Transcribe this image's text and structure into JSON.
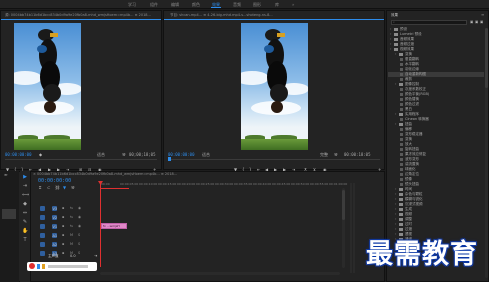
{
  "workspaces": [
    "学习",
    "组件",
    "编辑",
    "颜色",
    "效果",
    "音频",
    "图形",
    "库"
  ],
  "active_workspace_index": 4,
  "source_monitor": {
    "tab_title": "源: 0004bb74b11b6d1bcc834b0d9a9e20fb0a8-mhd_wmjsHoem=mp4b... ≡ 2018...",
    "timecode_left": "00:00:00:00",
    "timecode_right": "00;00;18;05",
    "fit": "适合"
  },
  "program_monitor": {
    "tab_title": "节目: shcan-mp4... ≡ 4-26-big-mhd.mp4-s...shoteng-ns-8...",
    "timecode_left": "00:00:00:00",
    "fit": "适合",
    "fraction": "完整",
    "timecode_right": "00:00:18:05"
  },
  "effects_panel": {
    "title": "效果",
    "search_placeholder": "",
    "items": [
      {
        "label": "预设",
        "level": 0,
        "type": "folder"
      },
      {
        "label": "Lumetri 预设",
        "level": 0,
        "type": "folder"
      },
      {
        "label": "音频效果",
        "level": 0,
        "type": "folder"
      },
      {
        "label": "音频过渡",
        "level": 0,
        "type": "folder"
      },
      {
        "label": "视频效果",
        "level": 0,
        "type": "folder"
      },
      {
        "label": "变换",
        "level": 1,
        "type": "folder"
      },
      {
        "label": "垂直翻转",
        "level": 2,
        "type": "effect"
      },
      {
        "label": "水平翻转",
        "level": 2,
        "type": "effect"
      },
      {
        "label": "羽化边缘",
        "level": 2,
        "type": "effect"
      },
      {
        "label": "自动重新构图",
        "level": 2,
        "type": "effect",
        "selected": true
      },
      {
        "label": "裁剪",
        "level": 2,
        "type": "effect"
      },
      {
        "label": "图像控制",
        "level": 1,
        "type": "folder"
      },
      {
        "label": "灰度系数校正",
        "level": 2,
        "type": "effect"
      },
      {
        "label": "颜色平衡(RGB)",
        "level": 2,
        "type": "effect"
      },
      {
        "label": "颜色替换",
        "level": 2,
        "type": "effect"
      },
      {
        "label": "颜色过滤",
        "level": 2,
        "type": "effect"
      },
      {
        "label": "黑白",
        "level": 2,
        "type": "effect"
      },
      {
        "label": "实用程序",
        "level": 1,
        "type": "folder"
      },
      {
        "label": "Cineon 转换器",
        "level": 2,
        "type": "effect"
      },
      {
        "label": "扭曲",
        "level": 1,
        "type": "folder"
      },
      {
        "label": "偏移",
        "level": 2,
        "type": "effect"
      },
      {
        "label": "变形稳定器",
        "level": 2,
        "type": "effect"
      },
      {
        "label": "变换",
        "level": 2,
        "type": "effect"
      },
      {
        "label": "放大",
        "level": 2,
        "type": "effect"
      },
      {
        "label": "旋转扭曲",
        "level": 2,
        "type": "effect"
      },
      {
        "label": "果冻效应修复",
        "level": 2,
        "type": "effect"
      },
      {
        "label": "波形变形",
        "level": 2,
        "type": "effect"
      },
      {
        "label": "湍流置换",
        "level": 2,
        "type": "effect"
      },
      {
        "label": "球面化",
        "level": 2,
        "type": "effect"
      },
      {
        "label": "边角定位",
        "level": 2,
        "type": "effect"
      },
      {
        "label": "镜像",
        "level": 2,
        "type": "effect"
      },
      {
        "label": "镜头扭曲",
        "level": 2,
        "type": "effect"
      },
      {
        "label": "时间",
        "level": 1,
        "type": "folder"
      },
      {
        "label": "杂色与颗粒",
        "level": 1,
        "type": "folder"
      },
      {
        "label": "模糊与锐化",
        "level": 1,
        "type": "folder"
      },
      {
        "label": "沉浸式视频",
        "level": 1,
        "type": "folder"
      },
      {
        "label": "生成",
        "level": 1,
        "type": "folder"
      },
      {
        "label": "视频",
        "level": 1,
        "type": "folder"
      },
      {
        "label": "调整",
        "level": 1,
        "type": "folder"
      },
      {
        "label": "过时",
        "level": 1,
        "type": "folder"
      },
      {
        "label": "过渡",
        "level": 1,
        "type": "folder"
      },
      {
        "label": "透视",
        "level": 1,
        "type": "folder"
      },
      {
        "label": "通道",
        "level": 1,
        "type": "folder"
      },
      {
        "label": "键控",
        "level": 1,
        "type": "folder"
      },
      {
        "label": "颜色校正",
        "level": 1,
        "type": "folder"
      },
      {
        "label": "风格化",
        "level": 1,
        "type": "folder"
      }
    ]
  },
  "timeline": {
    "tab_title": "×  0004bb74b11b6d1bcc834b0d9a9e20fb0a8-mhd_wmjsHoem=mp4b... ≡ 2018...",
    "timecode": "00:00:00:00",
    "ruler": [
      "00:00",
      "00:00:05:00",
      "00:00:10:00",
      "00:00:15:00",
      "00:00:20:00",
      "00:00:25:00",
      "00:00:30:00",
      "00:00:35:00",
      "00:00:40:00",
      "00:00:45:00",
      "00:00:50:00",
      "00:00:55:00",
      "00:01:00:00"
    ],
    "tracks": [
      "V3",
      "V2",
      "V1",
      "A1",
      "A2",
      "A3"
    ],
    "clip_label": "fx ...wmjsH",
    "master": "主声道",
    "master_value": "0.0"
  },
  "watermark": "最需教育",
  "colors": {
    "accent": "#2d8ceb",
    "clip": "#e088c8",
    "playhead": "#e03030",
    "sky": "#5b9bd8"
  }
}
